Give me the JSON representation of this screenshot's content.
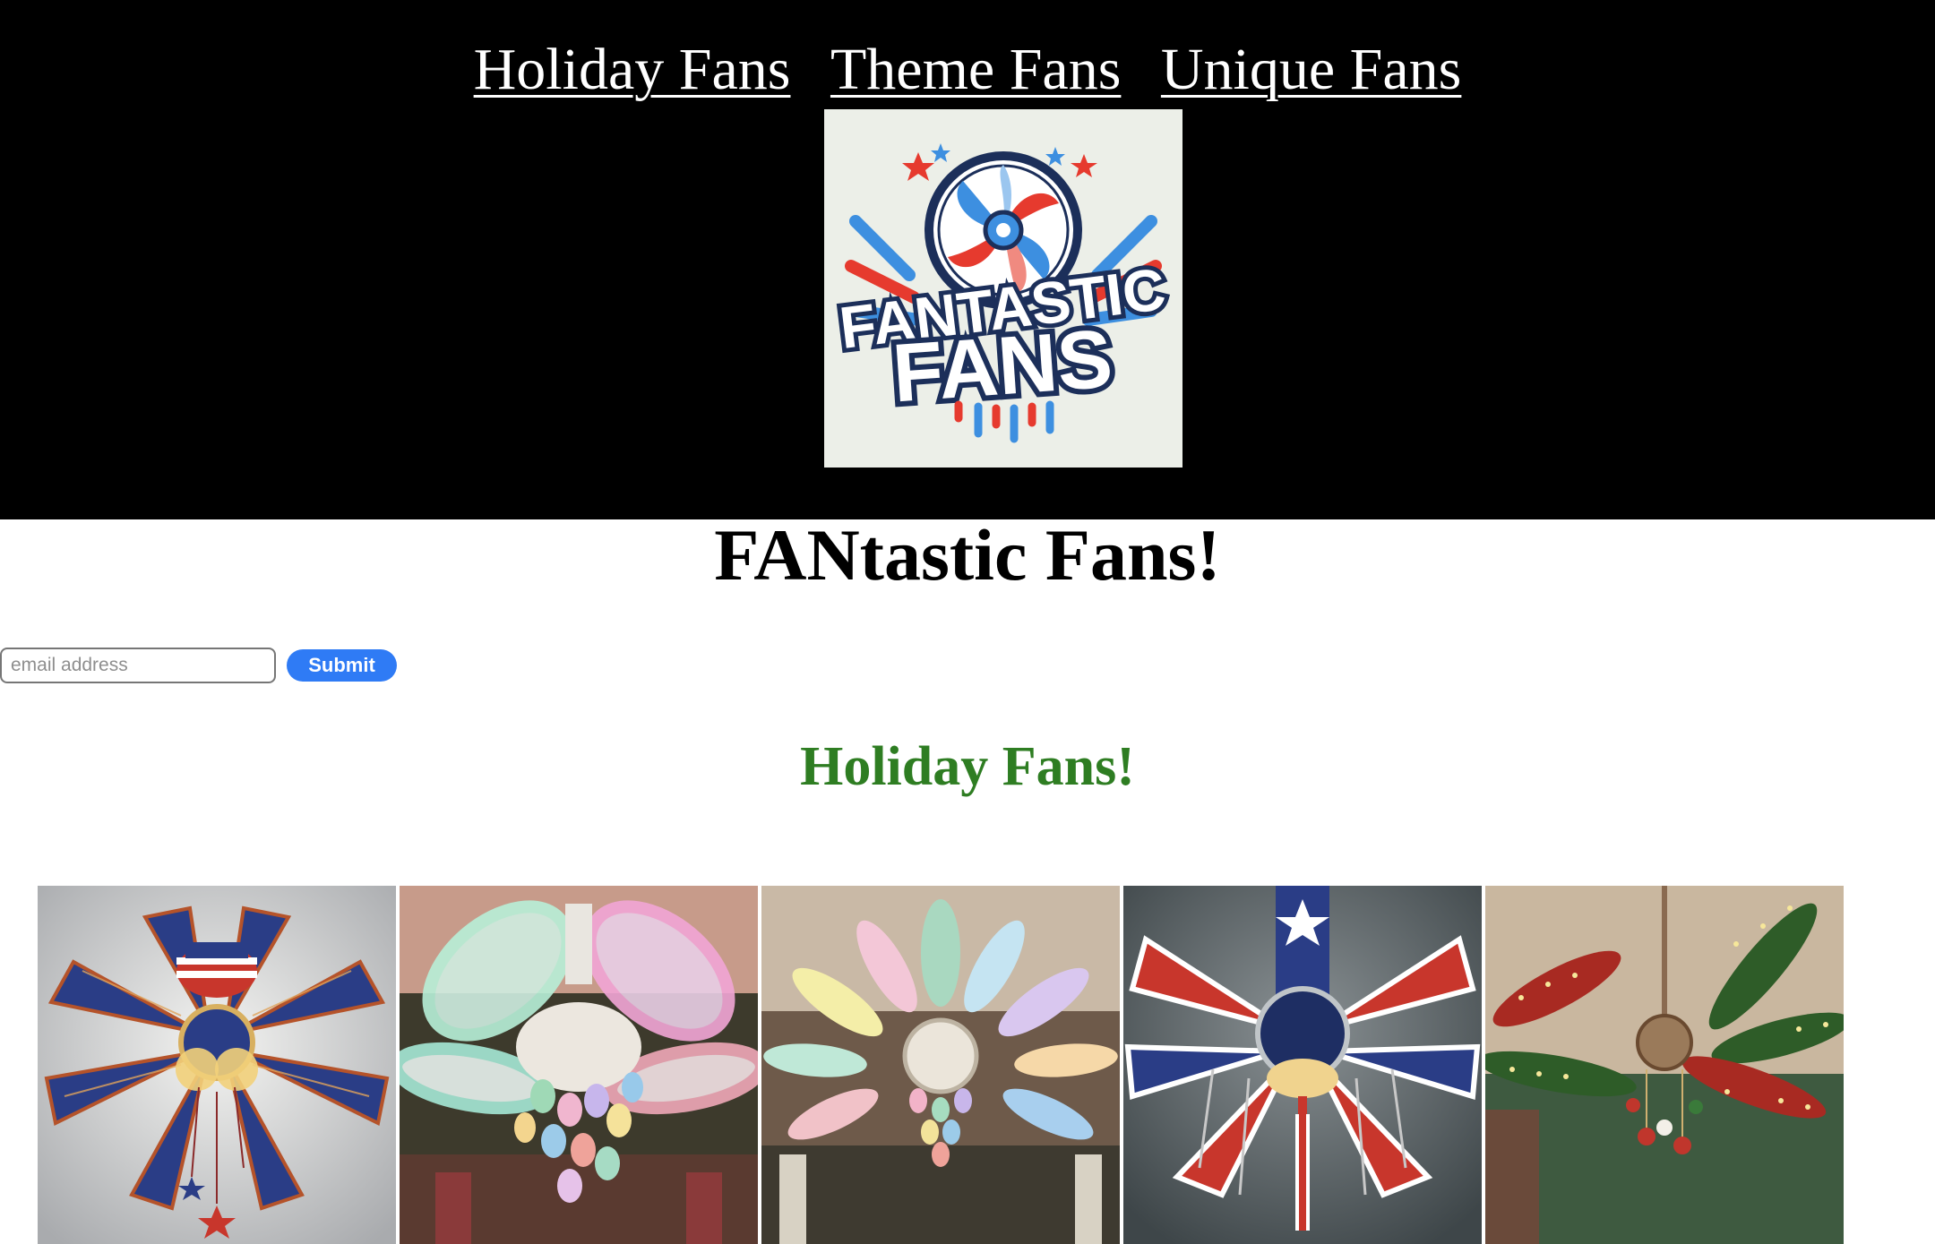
{
  "nav": {
    "links": [
      "Holiday Fans",
      "Theme Fans",
      "Unique Fans"
    ]
  },
  "logo": {
    "line1": "FANTASTIC",
    "line2": "FANS"
  },
  "page_title": "FANtastic Fans!",
  "signup": {
    "email_placeholder": "email address",
    "submit_label": "Submit"
  },
  "section_title": "Holiday Fans!",
  "gallery": {
    "items": [
      {
        "icon": "patriotic-fan-image"
      },
      {
        "icon": "easter-egg-fan-image"
      },
      {
        "icon": "pastel-chandelier-fan-image"
      },
      {
        "icon": "stars-stripes-fan-image"
      },
      {
        "icon": "christmas-lights-fan-image"
      }
    ]
  },
  "colors": {
    "header_bg": "#000000",
    "accent_blue": "#2f7bf5",
    "section_green": "#2e7d22"
  }
}
